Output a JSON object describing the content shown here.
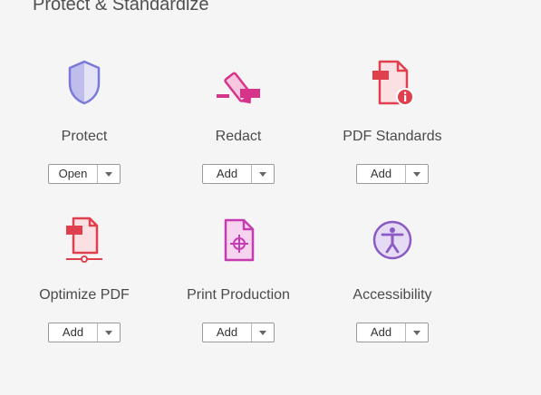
{
  "section": {
    "title": "Protect & Standardize"
  },
  "tools": [
    {
      "label": "Protect",
      "button": "Open",
      "icon": "shield-icon"
    },
    {
      "label": "Redact",
      "button": "Add",
      "icon": "redact-marker-icon"
    },
    {
      "label": "PDF Standards",
      "button": "Add",
      "icon": "pdf-standards-icon"
    },
    {
      "label": "Optimize PDF",
      "button": "Add",
      "icon": "optimize-pdf-icon"
    },
    {
      "label": "Print Production",
      "button": "Add",
      "icon": "print-production-icon"
    },
    {
      "label": "Accessibility",
      "button": "Add",
      "icon": "accessibility-icon"
    }
  ],
  "colors": {
    "shield": "#7b79d8",
    "redact": "#d6348a",
    "pdf_standards": "#e0404e",
    "optimize": "#e0404e",
    "print_production": "#c43cb0",
    "accessibility": "#8a5bc4"
  }
}
